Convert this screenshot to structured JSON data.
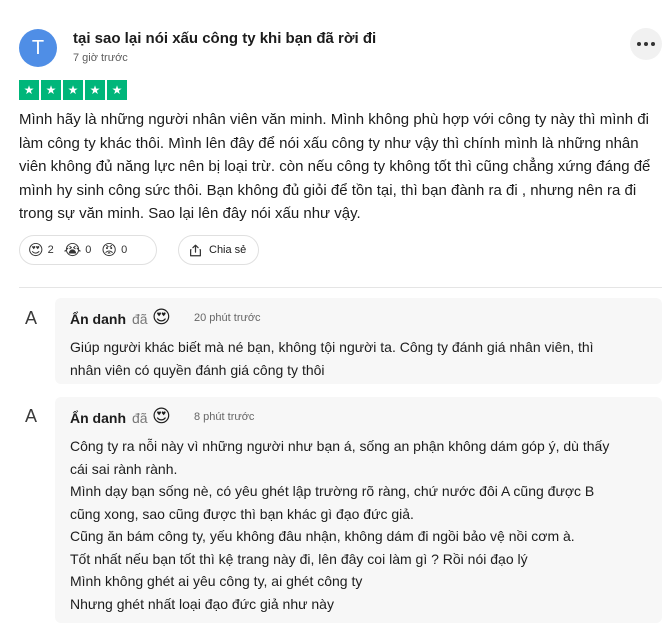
{
  "review": {
    "avatar_letter": "T",
    "title": "tại sao lại nói xấu công ty khi bạn đã rời đi",
    "time": "7 giờ trước",
    "rating": 5,
    "body": "Mình hãy là  những người nhân viên văn minh. Mình không phù hợp với công ty này thì mình đi làm công ty khác thôi. Mình lên đây để nói xấu công ty như vậy thì chính mình là những nhân viên không đủ năng lực nên bị loại trừ. còn nếu công ty không tốt thì cũng chẳng xứng đáng để mình hy sinh công sức thôi. Bạn không đủ giỏi để tồn tại, thì bạn đành ra đi , nhưng nên ra đi trong sự văn minh. Sao lại lên đây nói xấu như vậy.",
    "reactions": [
      {
        "icon": "heart-eyes-emoji",
        "glyph": "😍",
        "count": "2"
      },
      {
        "icon": "crying-emoji",
        "glyph": "😭",
        "count": "0"
      },
      {
        "icon": "angry-emoji",
        "glyph": "😡",
        "count": "0"
      }
    ],
    "share_label": "Chia sẻ",
    "star_color": "#00b67a"
  },
  "comments": [
    {
      "avatar_letter": "A",
      "author": "Ẩn danh",
      "verb": "đã",
      "reaction_glyph": "😍",
      "time": "20 phút trước",
      "lines": [
        "Giúp người khác biết mà né bạn, không tội người ta. Công ty đánh giá nhân viên, thì",
        "nhân viên có quyền đánh giá công ty thôi"
      ]
    },
    {
      "avatar_letter": "A",
      "author": "Ẩn danh",
      "verb": "đã",
      "reaction_glyph": "😍",
      "time": "8 phút trước",
      "lines": [
        "Công ty ra nỗi này vì những người như bạn á, sống an phận không dám góp ý, dù thấy",
        "cái sai rành rành.",
        "Mình dạy bạn sống nè, có yêu ghét lập trường rõ ràng, chứ nước đôi A cũng được B",
        "cũng xong, sao cũng được thì bạn khác gì đạo đức giả.",
        "Cũng ăn bám công ty, yếu không đâu nhận, không dám đi ngồi bảo vệ nồi cơm à.",
        "Tốt nhất nếu bạn tốt thì kệ trang này đi, lên đây coi làm gì ? Rồi nói đạo lý",
        "Mình không ghét ai yêu công ty, ai ghét công ty",
        "Nhưng ghét nhất loại đạo đức giả như này"
      ]
    }
  ]
}
